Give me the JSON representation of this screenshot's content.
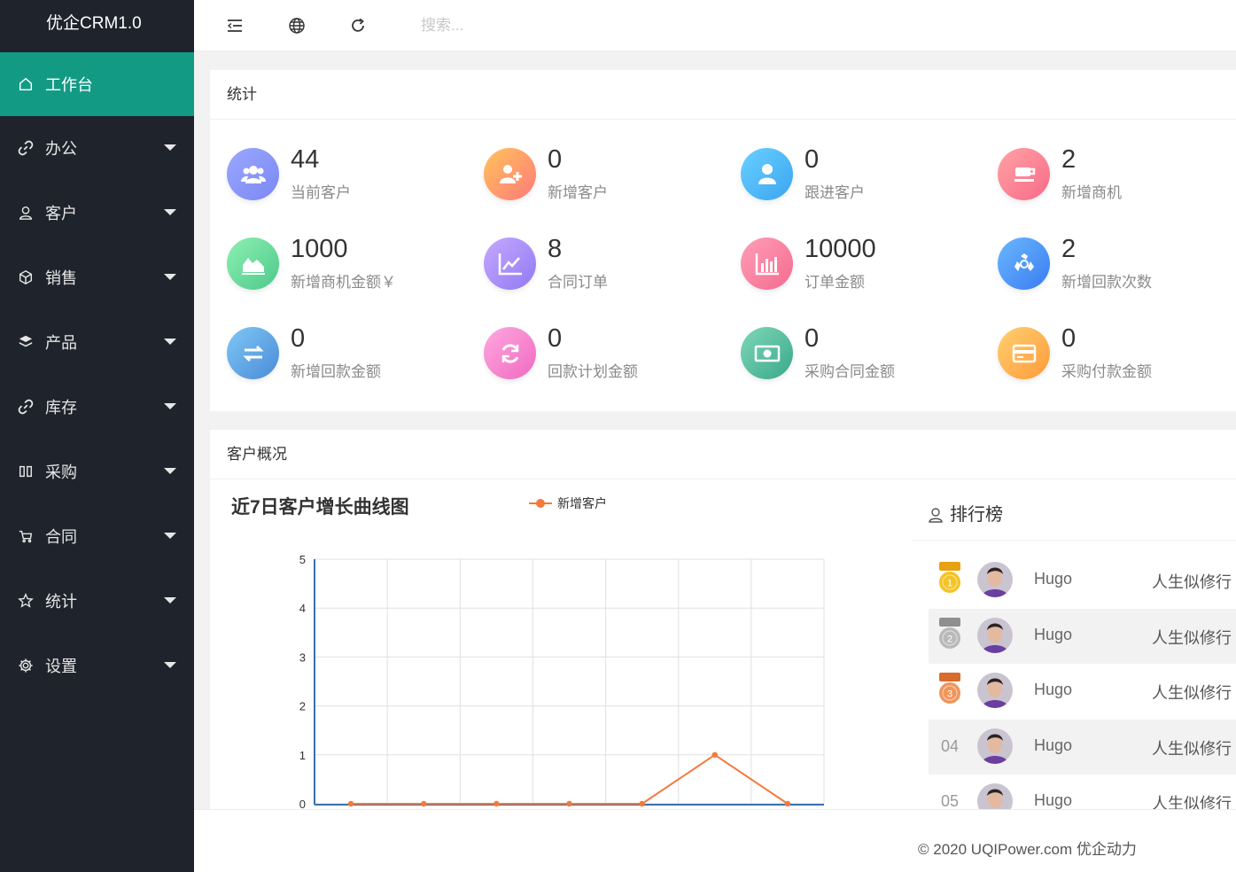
{
  "app": {
    "title": "优企CRM1.0"
  },
  "sidebar": {
    "items": [
      {
        "label": "工作台",
        "icon": "home-icon",
        "active": true
      },
      {
        "label": "办公",
        "icon": "link-icon"
      },
      {
        "label": "客户",
        "icon": "user-icon"
      },
      {
        "label": "销售",
        "icon": "cube-icon"
      },
      {
        "label": "产品",
        "icon": "layers-icon"
      },
      {
        "label": "库存",
        "icon": "link-icon"
      },
      {
        "label": "采购",
        "icon": "columns-icon"
      },
      {
        "label": "合同",
        "icon": "cart-icon"
      },
      {
        "label": "统计",
        "icon": "star-icon"
      },
      {
        "label": "设置",
        "icon": "gear-icon"
      }
    ],
    "bg_color": "#1f232b",
    "active_color": "#139a84"
  },
  "header": {
    "search_placeholder": "搜索...",
    "icons": [
      "menu-fold-icon",
      "globe-icon",
      "refresh-icon"
    ]
  },
  "stats": {
    "title": "统计",
    "items": [
      {
        "value": "44",
        "label": "当前客户",
        "icon": "users-icon",
        "color_from": "#9aa8ff",
        "color_to": "#7b87f2"
      },
      {
        "value": "0",
        "label": "新增客户",
        "icon": "user-plus-icon",
        "color_from": "#ffc35a",
        "color_to": "#ff7a7a"
      },
      {
        "value": "0",
        "label": "跟进客户",
        "icon": "user-icon",
        "color_from": "#6ad0ff",
        "color_to": "#3aa5f0"
      },
      {
        "value": "2",
        "label": "新增商机",
        "icon": "cup-icon",
        "color_from": "#ffa3a3",
        "color_to": "#f76a8a"
      },
      {
        "value": "1000",
        "label": "新增商机金额￥",
        "icon": "area-chart-icon",
        "color_from": "#8ef0b0",
        "color_to": "#4cc98c"
      },
      {
        "value": "8",
        "label": "合同订单",
        "icon": "line-chart-icon",
        "color_from": "#c7a8ff",
        "color_to": "#8f7af2"
      },
      {
        "value": "10000",
        "label": "订单金额",
        "icon": "bar-chart-icon",
        "color_from": "#ff9fb8",
        "color_to": "#f56a8e"
      },
      {
        "value": "2",
        "label": "新增回款次数",
        "icon": "recycle-icon",
        "color_from": "#6ab8ff",
        "color_to": "#3a7cf0"
      },
      {
        "value": "0",
        "label": "新增回款金额",
        "icon": "exchange-icon",
        "color_from": "#7ec8f5",
        "color_to": "#4a8ad8"
      },
      {
        "value": "0",
        "label": "回款计划金额",
        "icon": "sync-icon",
        "color_from": "#ffa8e0",
        "color_to": "#f06ac0"
      },
      {
        "value": "0",
        "label": "采购合同金额",
        "icon": "money-icon",
        "color_from": "#7ed8b8",
        "color_to": "#3aa88a"
      },
      {
        "value": "0",
        "label": "采购付款金额",
        "icon": "card-icon",
        "color_from": "#ffd070",
        "color_to": "#ff9a3a"
      }
    ]
  },
  "customer": {
    "title": "客户概况",
    "chart_title": "近7日客户增长曲线图"
  },
  "chart_data": {
    "type": "line",
    "title": "近7日客户增长曲线图",
    "x": [
      "",
      "",
      "",
      "",
      "",
      "",
      ""
    ],
    "series": [
      {
        "name": "新增客户",
        "values": [
          0,
          0,
          0,
          0,
          0,
          1,
          0
        ],
        "color": "#f5793a"
      }
    ],
    "ylim": [
      0,
      5
    ],
    "yticks": [
      0,
      1,
      2,
      3,
      4,
      5
    ],
    "grid": true,
    "legend": "top"
  },
  "ranking": {
    "title": "排行榜",
    "rows": [
      {
        "rank": "1",
        "medal": "gold",
        "name": "Hugo",
        "motto": "人生似修行"
      },
      {
        "rank": "2",
        "medal": "silver",
        "name": "Hugo",
        "motto": "人生似修行"
      },
      {
        "rank": "3",
        "medal": "bronze",
        "name": "Hugo",
        "motto": "人生似修行"
      },
      {
        "rank": "04",
        "medal": "",
        "name": "Hugo",
        "motto": "人生似修行"
      },
      {
        "rank": "05",
        "medal": "",
        "name": "Hugo",
        "motto": "人生似修行"
      }
    ]
  },
  "footer": {
    "text": "© 2020 UQIPower.com 优企动力"
  }
}
